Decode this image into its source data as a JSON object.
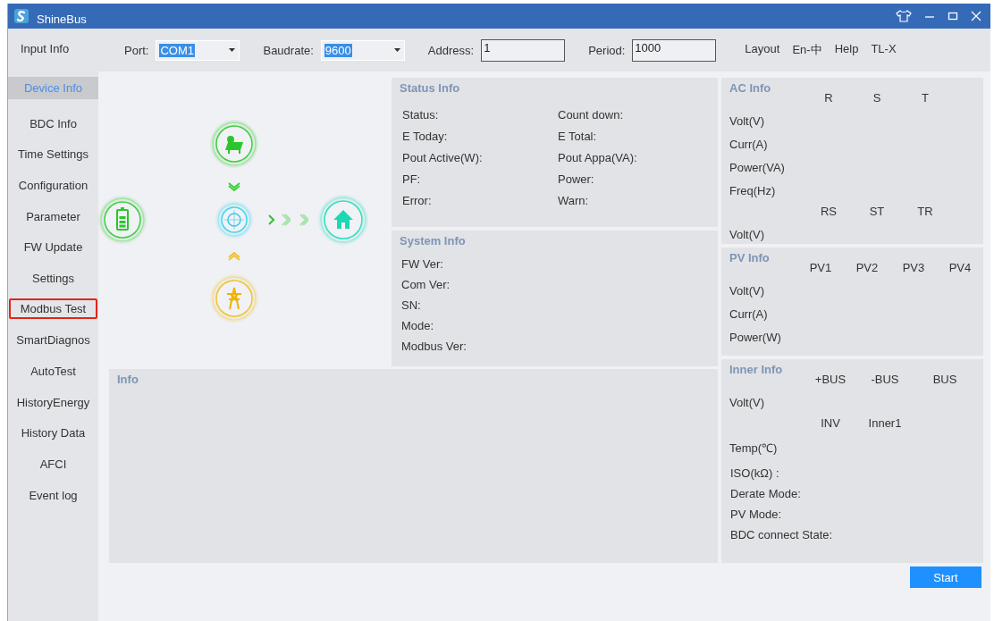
{
  "window": {
    "title": "ShineBus"
  },
  "toolbar": {
    "section_label": "Input Info",
    "fields": [
      {
        "kind": "dropdown",
        "label": "Port:",
        "value": "COM1"
      },
      {
        "kind": "dropdown",
        "label": "Baudrate:",
        "value": "9600"
      },
      {
        "kind": "text",
        "label": "Address:",
        "value": "1"
      },
      {
        "kind": "text",
        "label": "Period:",
        "value": "1000"
      }
    ],
    "menu": [
      "Layout",
      "En-中",
      "Help",
      "TL-X"
    ]
  },
  "sidebar": {
    "items": [
      {
        "label": "Device Info",
        "selected": true,
        "highlighted": false
      },
      {
        "label": "BDC Info",
        "selected": false,
        "highlighted": false
      },
      {
        "label": "Time Settings",
        "selected": false,
        "highlighted": false
      },
      {
        "label": "Configuration",
        "selected": false,
        "highlighted": false
      },
      {
        "label": "Parameter",
        "selected": false,
        "highlighted": false
      },
      {
        "label": "FW Update",
        "selected": false,
        "highlighted": false
      },
      {
        "label": "Settings",
        "selected": false,
        "highlighted": false
      },
      {
        "label": "Modbus Test",
        "selected": false,
        "highlighted": true
      },
      {
        "label": "SmartDiagnos",
        "selected": false,
        "highlighted": false
      },
      {
        "label": "AutoTest",
        "selected": false,
        "highlighted": false
      },
      {
        "label": "HistoryEnergy",
        "selected": false,
        "highlighted": false
      },
      {
        "label": "History Data",
        "selected": false,
        "highlighted": false
      },
      {
        "label": "AFCI",
        "selected": false,
        "highlighted": false
      },
      {
        "label": "Event log",
        "selected": false,
        "highlighted": false
      }
    ]
  },
  "status_info": {
    "title": "Status Info",
    "fields": [
      "Status:",
      "Count down:",
      "E Today:",
      "E Total:",
      "Pout Active(W):",
      "Pout Appa(VA):",
      "PF:",
      "Power:",
      "Error:",
      "Warn:"
    ]
  },
  "system_info": {
    "title": "System Info",
    "fields": [
      "FW Ver:",
      "Com Ver:",
      "SN:",
      "Mode:",
      "Modbus Ver:"
    ]
  },
  "info": {
    "title": "Info"
  },
  "ac_info": {
    "title": "AC Info",
    "groups": [
      {
        "columns": [
          "R",
          "S",
          "T"
        ],
        "rows": [
          "Volt(V)",
          "Curr(A)",
          "Power(VA)",
          "Freq(Hz)"
        ]
      },
      {
        "columns": [
          "RS",
          "ST",
          "TR"
        ],
        "rows": [
          "Volt(V)"
        ]
      }
    ]
  },
  "pv_info": {
    "title": "PV Info",
    "groups": [
      {
        "columns": [
          "PV1",
          "PV2",
          "PV3",
          "PV4"
        ],
        "rows": [
          "Volt(V)",
          "Curr(A)",
          "Power(W)"
        ]
      }
    ]
  },
  "inner_info": {
    "title": "Inner Info",
    "groups": [
      {
        "columns": [
          "+BUS",
          "-BUS",
          "BUS"
        ],
        "rows": [
          "Volt(V)"
        ]
      },
      {
        "columns": [
          "INV",
          "Inner1"
        ],
        "rows": [
          "Temp(℃)"
        ]
      }
    ],
    "fields": [
      "ISO(kΩ) :",
      "Derate Mode:",
      "PV Mode:",
      "BDC connect State:"
    ]
  },
  "start_button": "Start"
}
